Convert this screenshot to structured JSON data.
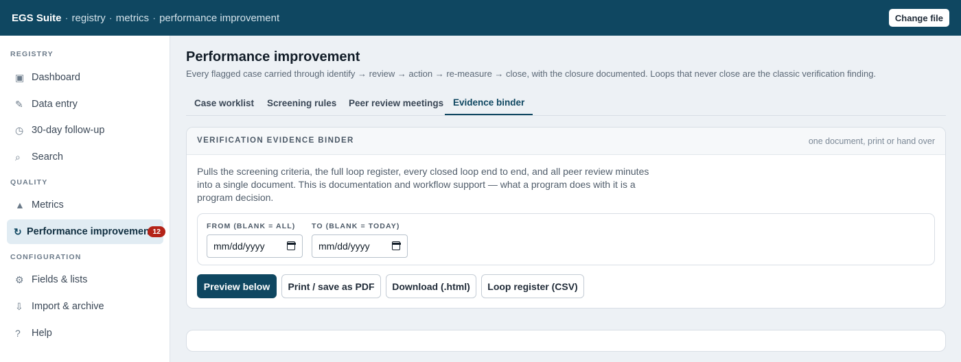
{
  "topbar": {
    "brand": "EGS Suite",
    "separator": "·",
    "breadcrumbs": [
      "registry",
      "metrics",
      "performance improvement"
    ],
    "change_file_label": "Change file"
  },
  "sidebar": {
    "sections": [
      {
        "label": "REGISTRY",
        "items": [
          {
            "label": "Dashboard",
            "icon": "▣",
            "icon_name": "dashboard-icon"
          },
          {
            "label": "Data entry",
            "icon": "✎",
            "icon_name": "pencil-icon"
          },
          {
            "label": "30-day follow-up",
            "icon": "◷",
            "icon_name": "clock-icon"
          },
          {
            "label": "Search",
            "icon": "⌕",
            "icon_name": "search-icon"
          }
        ]
      },
      {
        "label": "QUALITY",
        "items": [
          {
            "label": "Metrics",
            "icon": "▲",
            "icon_name": "metrics-icon"
          },
          {
            "label": "Performance improvement",
            "icon": "↻",
            "icon_name": "loop-icon",
            "badge": "12",
            "active": true
          }
        ]
      },
      {
        "label": "CONFIGURATION",
        "items": [
          {
            "label": "Fields & lists",
            "icon": "⚙",
            "icon_name": "gear-icon"
          },
          {
            "label": "Import & archive",
            "icon": "⇩",
            "icon_name": "download-icon"
          },
          {
            "label": "Help",
            "icon": "?",
            "icon_name": "help-icon"
          }
        ]
      }
    ]
  },
  "main": {
    "title": "Performance improvement",
    "subtitle": "Every flagged case carried through identify → review → action → re-measure → close, with the closure documented. Loops that never close are the classic verification finding.",
    "tabs": [
      {
        "label": "Case worklist"
      },
      {
        "label": "Screening rules"
      },
      {
        "label": "Peer review meetings"
      },
      {
        "label": "Evidence binder",
        "active": true
      }
    ],
    "card": {
      "title": "VERIFICATION EVIDENCE BINDER",
      "note": "one document, print or hand over",
      "description": "Pulls the screening criteria, the full loop register, every closed loop end to end, and all peer review minutes into a single document. This is documentation and workflow support — what a program does with it is a program decision.",
      "from_label": "FROM (BLANK = ALL)",
      "to_label": "TO (BLANK = TODAY)",
      "from_value": "mm/dd/yyyy",
      "to_value": "mm/dd/yyyy",
      "buttons": {
        "preview": "Preview below",
        "print": "Print / save as PDF",
        "download": "Download (.html)",
        "loop_register": "Loop register (CSV)"
      }
    }
  },
  "colors": {
    "topbar": "#0f4761",
    "accent": "#0f4761",
    "badge": "#b42318",
    "background": "#edf1f5"
  }
}
